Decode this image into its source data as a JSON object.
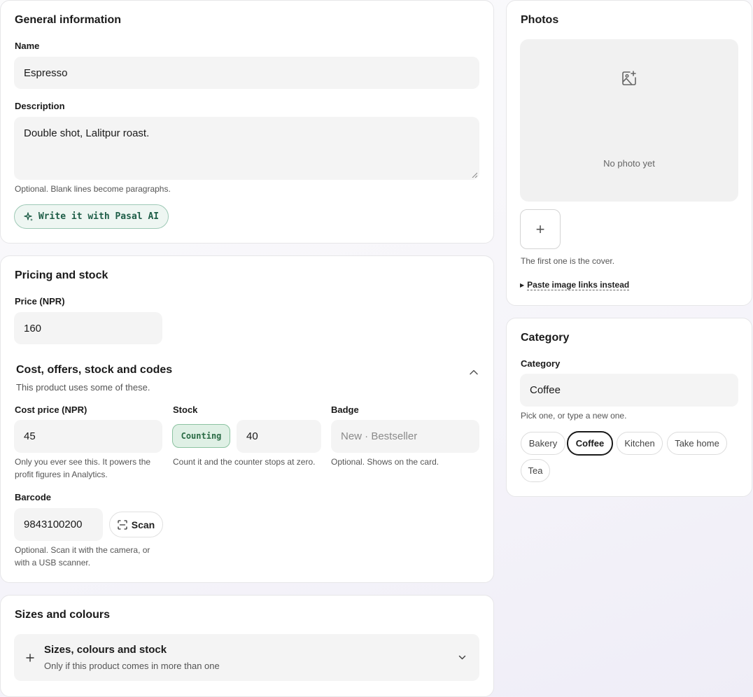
{
  "general": {
    "title": "General information",
    "name_label": "Name",
    "name_value": "Espresso",
    "description_label": "Description",
    "description_value": "Double shot, Lalitpur roast.",
    "description_hint": "Optional. Blank lines become paragraphs.",
    "ai_button": "Write it with Pasal AI"
  },
  "pricing": {
    "title": "Pricing and stock",
    "price_label": "Price (NPR)",
    "price_value": "160",
    "more_title": "Cost, offers, stock and codes",
    "more_subtitle": "This product uses some of these.",
    "cost_label": "Cost price (NPR)",
    "cost_value": "45",
    "cost_hint": "Only you ever see this. It powers the profit figures in Analytics.",
    "stock_label": "Stock",
    "stock_badge": "Counting",
    "stock_value": "40",
    "stock_hint": "Count it and the counter stops at zero.",
    "badge_label": "Badge",
    "badge_placeholder": "New · Bestseller",
    "badge_hint": "Optional. Shows on the card.",
    "barcode_label": "Barcode",
    "barcode_value": "9843100200",
    "scan_button": "Scan",
    "barcode_hint": "Optional. Scan it with the camera, or with a USB scanner."
  },
  "variants": {
    "title": "Sizes and colours",
    "row_title": "Sizes, colours and stock",
    "row_subtitle": "Only if this product comes in more than one"
  },
  "photos": {
    "title": "Photos",
    "empty_text": "No photo yet",
    "cover_hint": "The first one is the cover.",
    "paste_link": "Paste image links instead"
  },
  "category": {
    "title": "Category",
    "label": "Category",
    "value": "Coffee",
    "hint": "Pick one, or type a new one.",
    "options": [
      "Bakery",
      "Coffee",
      "Kitchen",
      "Take home",
      "Tea"
    ],
    "selected": "Coffee"
  },
  "colors": {
    "accent_green": "#1f5e48",
    "counting_bg": "#dff0e5"
  }
}
